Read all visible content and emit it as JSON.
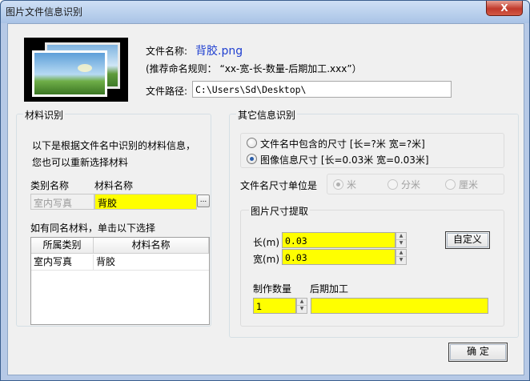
{
  "window": {
    "title": "图片文件信息识别",
    "close_glyph": "X"
  },
  "file": {
    "name_label": "文件名称:",
    "name_value": "背胶.png",
    "rule_text": "(推荐命名规则： “xx-宽-长-数量-后期加工.xxx”）",
    "path_label": "文件路径:",
    "path_value": "C:\\Users\\Sd\\Desktop\\"
  },
  "material": {
    "group_title": "材料识别",
    "info_line1": "以下是根据文件名中识别的材料信息，",
    "info_line2": "您也可以重新选择材料",
    "category_label": "类别名称",
    "material_label": "材料名称",
    "category_value": "室内写真",
    "material_value": "背胶",
    "browse_glyph": "...",
    "same_name_label": "如有同名材料，单击以下选择",
    "table": {
      "headers": [
        "所属类别",
        "材料名称"
      ],
      "rows": [
        [
          "室内写真",
          "背胶"
        ]
      ]
    }
  },
  "other": {
    "group_title": "其它信息识别",
    "size_source": [
      {
        "label": "文件名中包含的尺寸 [长=?米  宽=?米]",
        "checked": false
      },
      {
        "label": "图像信息尺寸 [长=0.03米  宽=0.03米]",
        "checked": true
      }
    ],
    "unit_label": "文件名尺寸单位是",
    "units": [
      {
        "label": "米",
        "checked": true
      },
      {
        "label": "分米",
        "checked": false
      },
      {
        "label": "厘米",
        "checked": false
      }
    ],
    "extract_title": "图片尺寸提取",
    "length_label": "长(m)",
    "length_value": "0.03",
    "width_label": "宽(m)",
    "width_value": "0.03",
    "custom_button": "自定义",
    "quantity_label": "制作数量",
    "post_label": "后期加工",
    "quantity_value": "1",
    "post_value": ""
  },
  "footer": {
    "ok_button": "确  定"
  },
  "colors": {
    "highlight": "#ffff00",
    "filename_blue": "#1f3fd0",
    "frame": "#b6c9e6"
  }
}
